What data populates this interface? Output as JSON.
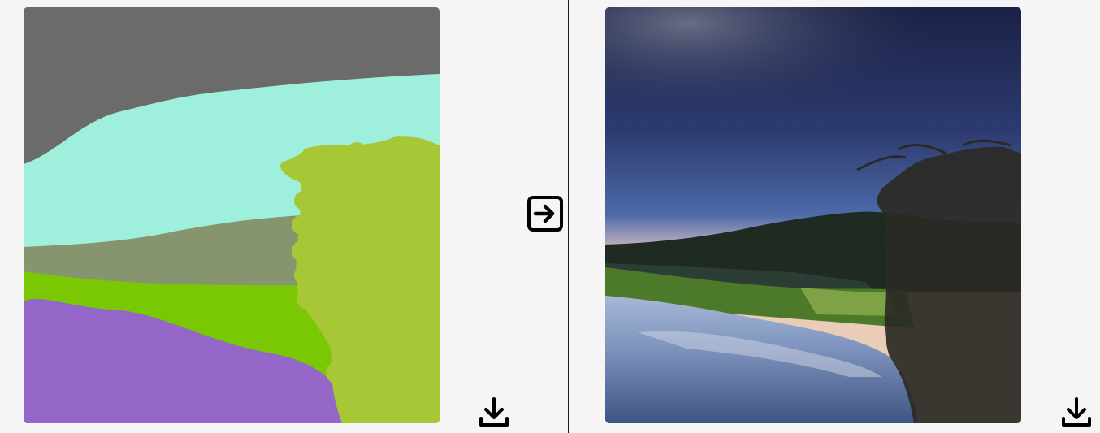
{
  "sketch": {
    "download_icon": "download-icon",
    "colors": {
      "sky": "#6b6b6b",
      "water": "#9ef0dc",
      "mountain": "#86956e",
      "grass": "#79c803",
      "river": "#9366c8",
      "tree": "#a7c736"
    }
  },
  "middle": {
    "convert_icon": "arrow-right-box-icon"
  },
  "result": {
    "download_icon": "download-icon",
    "colors": {
      "sky_top": "#1c2650",
      "sky_horizon": "#e6c9b6",
      "hill": "#1f2a22",
      "grass": "#4d7a2a",
      "water": "#8fa6c9",
      "trees": "#2a2a24"
    }
  }
}
